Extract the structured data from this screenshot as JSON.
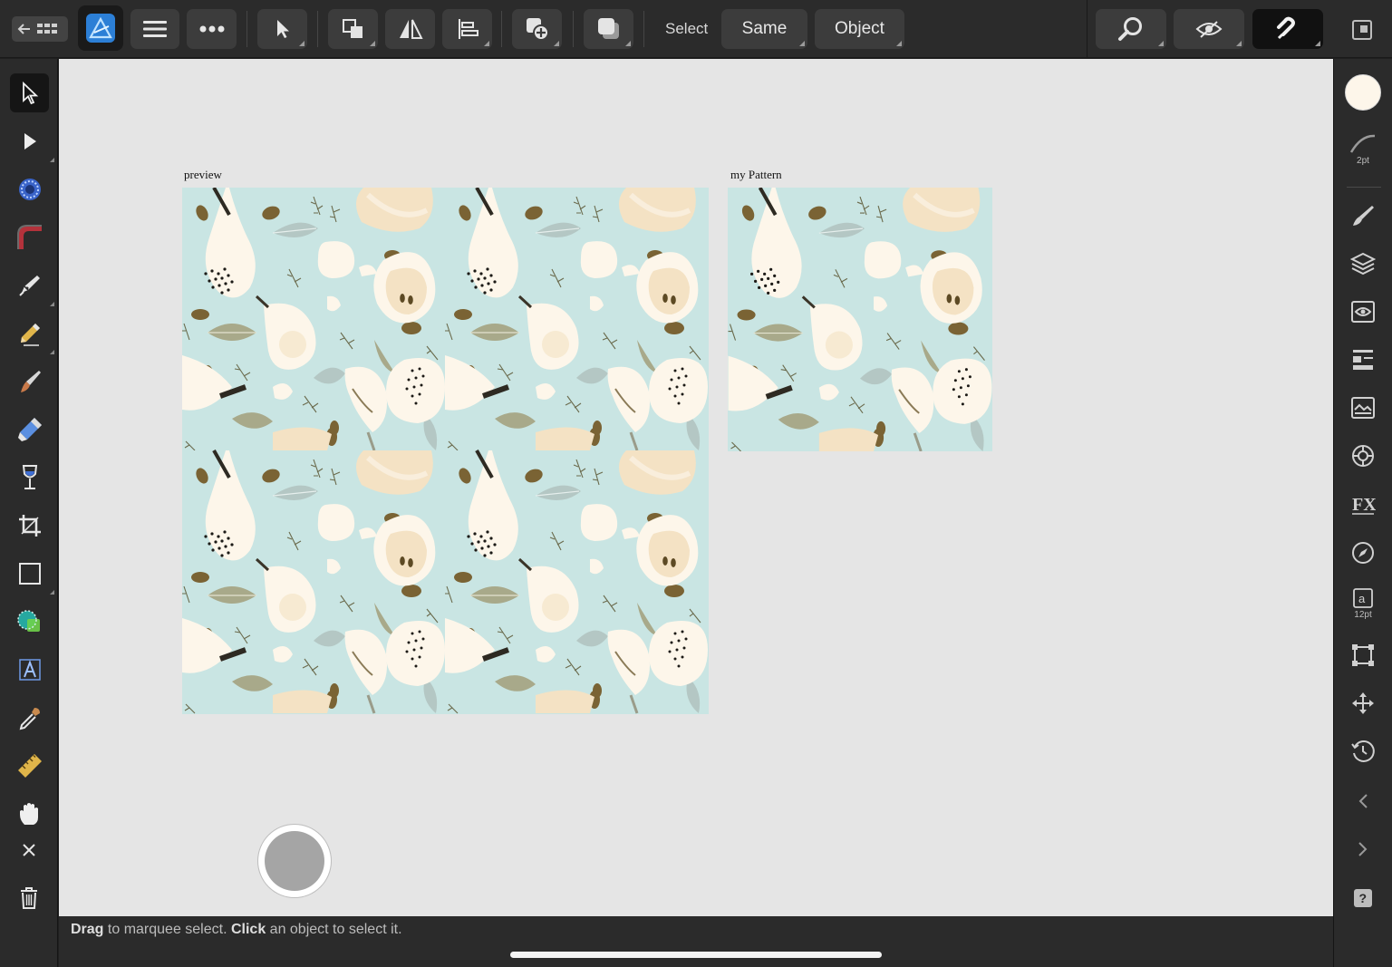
{
  "toolbar": {
    "select_label": "Select",
    "same_label": "Same",
    "object_label": "Object"
  },
  "canvas": {
    "preview_label": "preview",
    "pattern_label": "my Pattern"
  },
  "right_panel": {
    "stroke_width": "2pt",
    "text_size": "12pt"
  },
  "status": {
    "drag": "Drag",
    "drag_rest": " to marquee select. ",
    "click": "Click",
    "click_rest": " an object to select it."
  },
  "colors": {
    "pattern_bg": "#c9e5e3",
    "pear_cream": "#fdf6ea",
    "pear_peach": "#f4e2c4",
    "seed_brown": "#7a6334",
    "leaf_sage": "#a8a98a",
    "leaf_grey": "#b4c7c4"
  }
}
